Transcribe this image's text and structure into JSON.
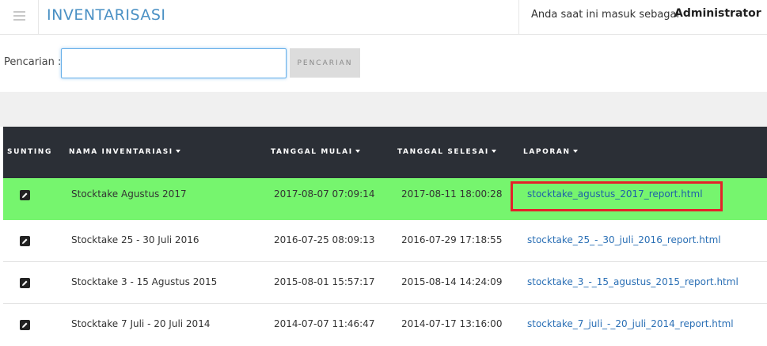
{
  "header": {
    "app_title": "INVENTARISASI",
    "logged_in_prefix": "Anda saat ini masuk sebagai",
    "user_role": "Administrator"
  },
  "search": {
    "label": "Pencarian :",
    "value": "",
    "button_label": "PENCARIAN"
  },
  "table": {
    "columns": [
      {
        "label": "SUNTING",
        "sortable": false
      },
      {
        "label": "NAMA INVENTARIASI",
        "sortable": true
      },
      {
        "label": "TANGGAL MULAI",
        "sortable": true
      },
      {
        "label": "TANGGAL SELESAI",
        "sortable": true
      },
      {
        "label": "LAPORAN",
        "sortable": true
      }
    ],
    "rows": [
      {
        "name": "Stocktake Agustus 2017",
        "start": "2017-08-07 07:09:14",
        "end": "2017-08-11 18:00:28",
        "report": "stocktake_agustus_2017_report.html",
        "highlighted": true
      },
      {
        "name": "Stocktake 25 - 30 Juli 2016",
        "start": "2016-07-25 08:09:13",
        "end": "2016-07-29 17:18:55",
        "report": "stocktake_25_-_30_juli_2016_report.html",
        "highlighted": false
      },
      {
        "name": "Stocktake 3 - 15 Agustus 2015",
        "start": "2015-08-01 15:57:17",
        "end": "2015-08-14 14:24:09",
        "report": "stocktake_3_-_15_agustus_2015_report.html",
        "highlighted": false
      },
      {
        "name": "Stocktake 7 Juli - 20 Juli 2014",
        "start": "2014-07-07 11:46:47",
        "end": "2014-07-17 13:16:00",
        "report": "stocktake_7_juli_-_20_juli_2014_report.html",
        "highlighted": false
      }
    ]
  },
  "icons": {
    "menu": "hamburger-menu-icon",
    "edit": "pencil-edit-icon",
    "sort": "caret-down-icon"
  },
  "colors": {
    "title_blue": "#4a90c4",
    "header_dark": "#2b2f36",
    "highlight_green": "#76f56e",
    "annotation_red": "#e4222a",
    "link_blue": "#2a6fb5"
  }
}
